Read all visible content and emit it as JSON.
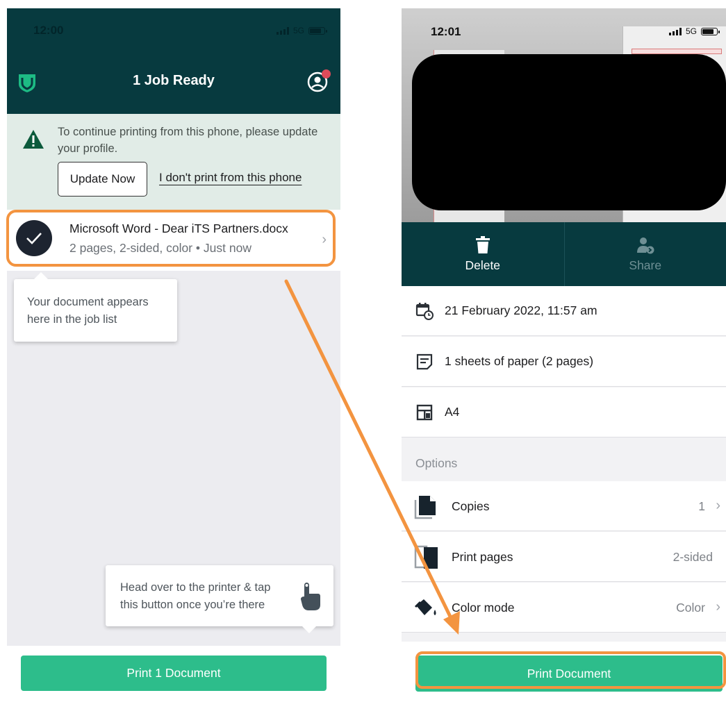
{
  "left": {
    "status": {
      "time": "12:00",
      "network": "5G"
    },
    "header": {
      "title": "1 Job Ready"
    },
    "banner": {
      "message": "To continue printing from this phone, please update your profile.",
      "update_button": "Update Now",
      "no_print_link": "I don't print from this phone"
    },
    "job": {
      "name": "Microsoft Word - Dear iTS Partners.docx",
      "meta": "2 pages, 2-sided, color • Just now"
    },
    "tips": {
      "job_list": "Your document appears here in the job list",
      "printer": "Head over to the printer & tap this button once you’re there"
    },
    "print_button": "Print 1 Document"
  },
  "right": {
    "status": {
      "time": "12:01",
      "network": "5G"
    },
    "actions": {
      "delete": "Delete",
      "share": "Share"
    },
    "details": {
      "date": "21 February 2022, 11:57 am",
      "sheets": "1 sheets of paper (2 pages)",
      "paper_size": "A4"
    },
    "options": {
      "header": "Options",
      "copies": {
        "label": "Copies",
        "value": "1"
      },
      "print_pages": {
        "label": "Print pages",
        "value": "2-sided"
      },
      "color_mode": {
        "label": "Color mode",
        "value": "Color"
      }
    },
    "print_button": "Print Document"
  },
  "colors": {
    "header_bg": "#073a3f",
    "accent_green": "#2dbd8b",
    "banner_bg": "#e1ece7",
    "annotation_orange": "#f39440",
    "notification_dot": "#e04b5a"
  },
  "icons": {
    "logo": "shield-check-icon",
    "profile": "profile-icon",
    "warning": "warning-icon",
    "checkmark": "checkmark-icon",
    "chevron": "chevron-right-icon",
    "hand": "hand-tap-icon",
    "delete": "trash-icon",
    "share": "share-user-icon",
    "calendar": "calendar-clock-icon",
    "sheets": "document-lines-icon",
    "paper": "layout-icon",
    "copies": "copies-icon",
    "print_pages": "duplex-icon",
    "color_mode": "paint-bucket-icon"
  }
}
